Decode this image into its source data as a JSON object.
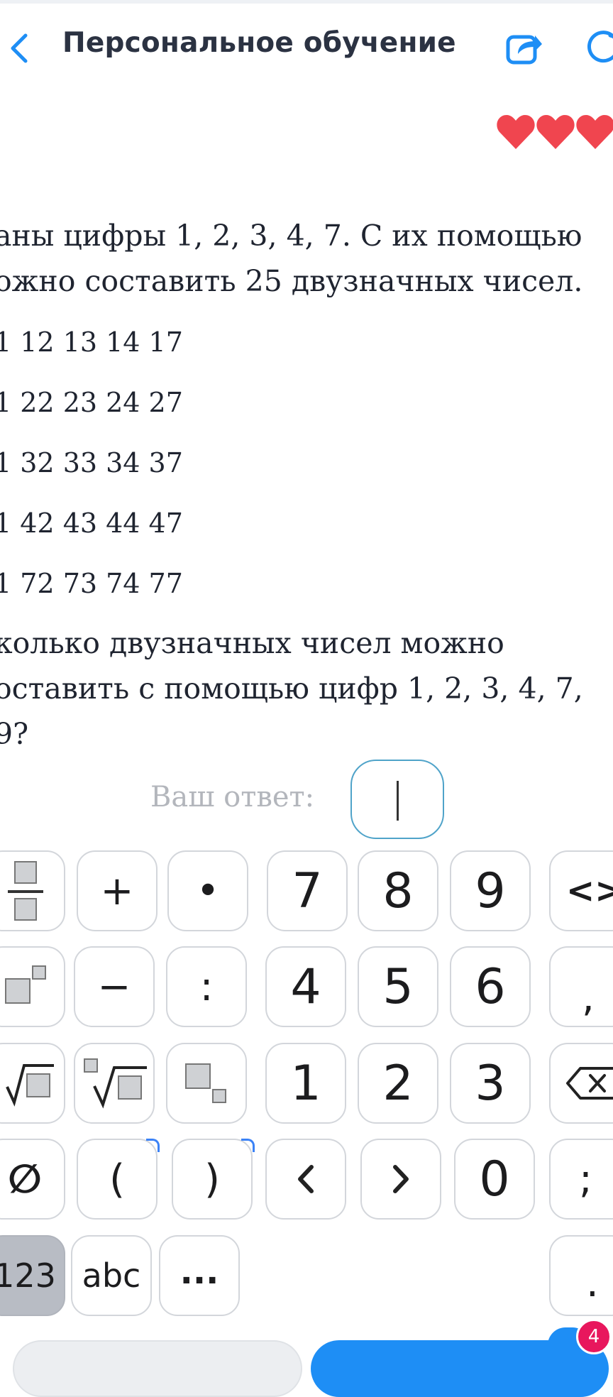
{
  "header": {
    "title": "Персональное обучение"
  },
  "icons": {
    "back": "chevron-left-icon",
    "share": "share-icon",
    "refresh": "refresh-icon",
    "hearts": [
      "heart-icon",
      "heart-icon",
      "heart-icon"
    ]
  },
  "colors": {
    "accent": "#1e8ef5",
    "heart": "#f0454f",
    "badge": "#e8175d"
  },
  "task": {
    "intro_line1": "аны цифры 1, 2, 3, 4, 7. С их помощью",
    "intro_line2": "ожно составить 25 двузначных чисел.",
    "rows": [
      "1 12 13 14 17",
      "1 22 23 24 27",
      "1 32 33 34 37",
      "1 42 43 44 47",
      "1 72 73 74 77"
    ],
    "question_line1": "колько двузначных чисел можно",
    "question_line2": "оставить с помощью цифр 1, 2, 3, 4, 7, 9?"
  },
  "answer": {
    "label": "Ваш ответ:",
    "value": ""
  },
  "keypad": {
    "row1": [
      "fraction",
      "+",
      "•",
      "7",
      "8",
      "9",
      "<>"
    ],
    "row2": [
      "power",
      "−",
      ":",
      "4",
      "5",
      "6",
      ","
    ],
    "row3": [
      "sqrt",
      "nth-root",
      "subscript",
      "1",
      "2",
      "3",
      "backspace"
    ],
    "row4": [
      "∅",
      "(",
      ")",
      "‹",
      "›",
      "0",
      ";"
    ],
    "row5": [
      "123",
      "abc",
      "...",
      "."
    ]
  },
  "bottom": {
    "badge_count": "4"
  }
}
